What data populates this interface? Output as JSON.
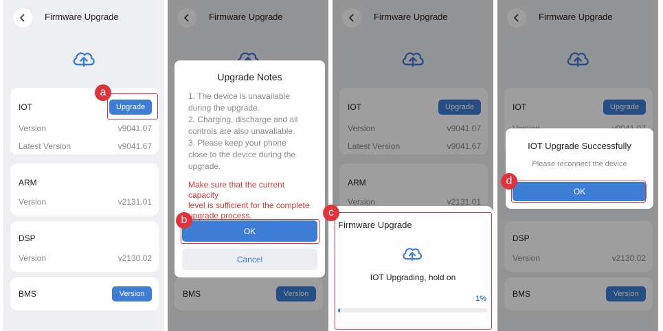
{
  "header": {
    "title": "Firmware Upgrade"
  },
  "colors": {
    "accent": "#3e7dd6",
    "warning": "#d83a3a",
    "marker": "#e0343c"
  },
  "icons": {
    "back": "chevron-left-icon",
    "cloud": "cloud-upload-icon"
  },
  "modules": {
    "iot": {
      "name": "IOT",
      "button": "Upgrade",
      "version_label": "Version",
      "version": "v9041.07",
      "latest_label": "Latest Version",
      "latest": "v9041.67"
    },
    "arm": {
      "name": "ARM",
      "version_label": "Version",
      "version": "v2131.01"
    },
    "dsp": {
      "name": "DSP",
      "version_label": "Version",
      "version": "v2130.02"
    },
    "bms": {
      "name": "BMS",
      "button": "Version"
    }
  },
  "notes": {
    "title": "Upgrade Notes",
    "body": "1. The device is unavailable\nduring the upgrade.\n2. Charging, discharge and all\ncontrols are also unavaliable.\n3. Please keep your phone\nclose to the device during the\nupgrade.",
    "warning": "Make sure that the current capacity\nlevel is sufficient for the complete\nupgrade process.",
    "ok": "OK",
    "cancel": "Cancel"
  },
  "progress": {
    "title": "Firmware Upgrade",
    "status": "IOT Upgrading, hold on",
    "percent_label": "1%",
    "fraction": 0.01
  },
  "success": {
    "title": "IOT Upgrade Successfully",
    "subtitle": "Please reconnect the device",
    "ok": "OK"
  },
  "markers": {
    "a": "a",
    "b": "b",
    "c": "c",
    "d": "d"
  }
}
